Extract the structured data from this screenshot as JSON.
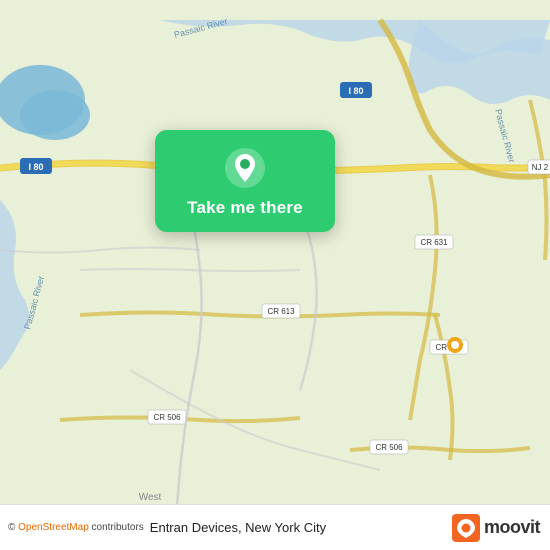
{
  "map": {
    "background_color": "#e8f0d8"
  },
  "card": {
    "label": "Take me there",
    "background_color": "#27ae60"
  },
  "bottom_bar": {
    "attribution_prefix": "© ",
    "attribution_link_text": "OpenStreetMap",
    "attribution_suffix": " contributors",
    "location_text": "Entran Devices, New York City"
  },
  "moovit": {
    "logo_text": "moovit"
  },
  "icons": {
    "pin": "location-pin-icon",
    "moovit_m": "moovit-brand-icon"
  }
}
